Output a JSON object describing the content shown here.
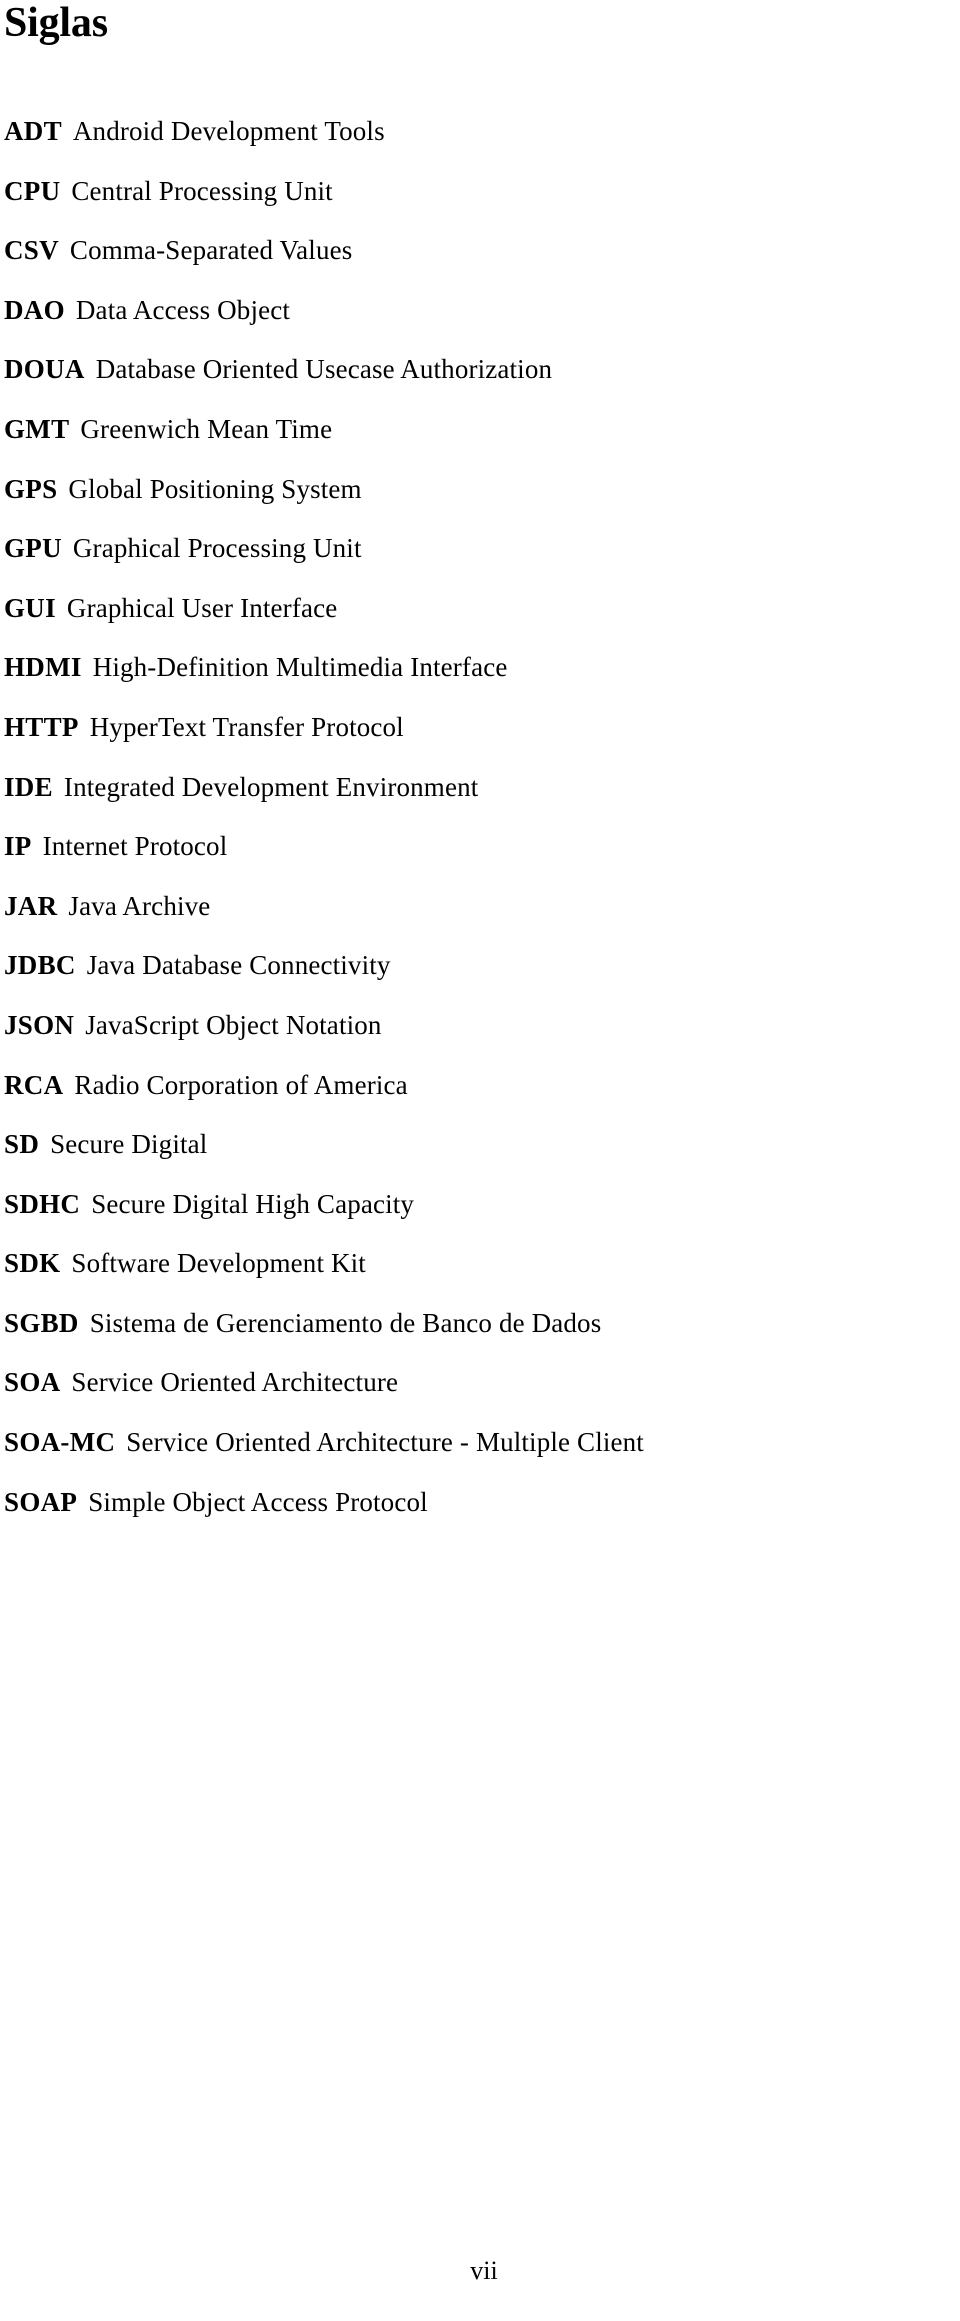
{
  "document": {
    "title": "Siglas",
    "page_number": "vii"
  },
  "acronyms": [
    {
      "abbr": "ADT",
      "desc": "Android Development Tools"
    },
    {
      "abbr": "CPU",
      "desc": "Central Processing Unit"
    },
    {
      "abbr": "CSV",
      "desc": "Comma-Separated Values"
    },
    {
      "abbr": "DAO",
      "desc": "Data Access Object"
    },
    {
      "abbr": "DOUA",
      "desc": "Database Oriented Usecase Authorization"
    },
    {
      "abbr": "GMT",
      "desc": "Greenwich Mean Time"
    },
    {
      "abbr": "GPS",
      "desc": "Global Positioning System"
    },
    {
      "abbr": "GPU",
      "desc": "Graphical Processing Unit"
    },
    {
      "abbr": "GUI",
      "desc": "Graphical User Interface"
    },
    {
      "abbr": "HDMI",
      "desc": "High-Definition Multimedia Interface"
    },
    {
      "abbr": "HTTP",
      "desc": "HyperText Transfer Protocol"
    },
    {
      "abbr": "IDE",
      "desc": "Integrated Development Environment"
    },
    {
      "abbr": "IP",
      "desc": "Internet Protocol"
    },
    {
      "abbr": "JAR",
      "desc": "Java Archive"
    },
    {
      "abbr": "JDBC",
      "desc": "Java Database Connectivity"
    },
    {
      "abbr": "JSON",
      "desc": "JavaScript Object Notation"
    },
    {
      "abbr": "RCA",
      "desc": "Radio Corporation of America"
    },
    {
      "abbr": "SD",
      "desc": "Secure Digital"
    },
    {
      "abbr": "SDHC",
      "desc": "Secure Digital High Capacity"
    },
    {
      "abbr": "SDK",
      "desc": "Software Development Kit"
    },
    {
      "abbr": "SGBD",
      "desc": "Sistema de Gerenciamento de Banco de Dados"
    },
    {
      "abbr": "SOA",
      "desc": "Service Oriented Architecture"
    },
    {
      "abbr": "SOA-MC",
      "desc": "Service Oriented Architecture - Multiple Client"
    },
    {
      "abbr": "SOAP",
      "desc": "Simple Object Access Protocol"
    }
  ]
}
